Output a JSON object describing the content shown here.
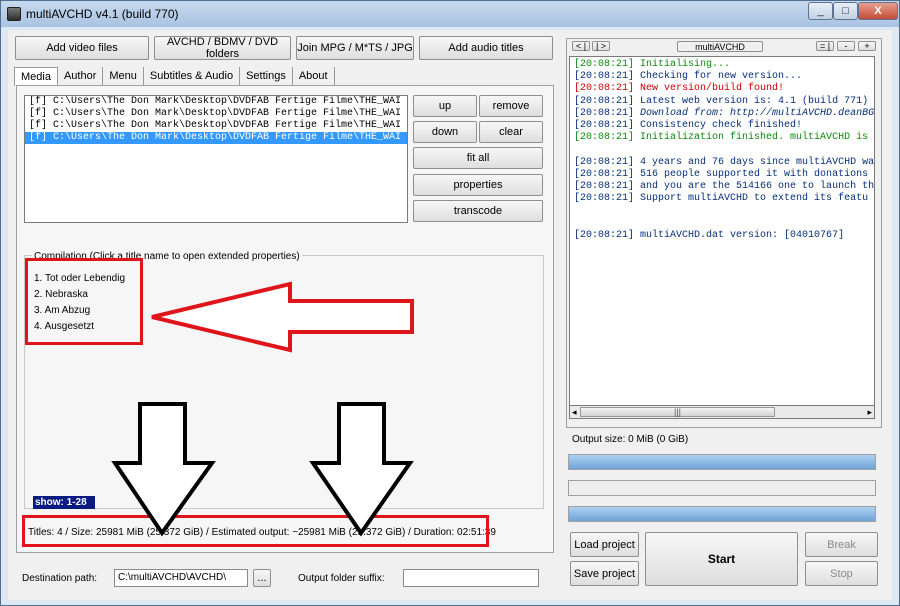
{
  "window": {
    "title": "multiAVCHD v4.1 (build 770)",
    "min": "_",
    "max": "□",
    "close": "X"
  },
  "toolbar": {
    "add_video": "Add video files",
    "avchd": "AVCHD / BDMV / DVD folders",
    "join": "Join MPG / M*TS / JPG",
    "add_audio": "Add audio titles"
  },
  "tabs": [
    "Media",
    "Author",
    "Menu",
    "Subtitles & Audio",
    "Settings",
    "About"
  ],
  "files": [
    "[f] C:\\Users\\The Don Mark\\Desktop\\DVDFAB Fertige Filme\\THE_WAI",
    "[f] C:\\Users\\The Don Mark\\Desktop\\DVDFAB Fertige Filme\\THE_WAI",
    "[f] C:\\Users\\The Don Mark\\Desktop\\DVDFAB Fertige Filme\\THE_WAI",
    "[f] C:\\Users\\The Don Mark\\Desktop\\DVDFAB Fertige Filme\\THE_WAI"
  ],
  "file_buttons": {
    "up": "up",
    "remove": "remove",
    "down": "down",
    "clear": "clear",
    "fit_all": "fit all",
    "properties": "properties",
    "transcode": "transcode"
  },
  "compilation": {
    "label": "Compilation (Click a title name to open extended properties)",
    "titles": [
      "1. Tot oder Lebendig",
      "2. Nebraska",
      "3. Am Abzug",
      "4. Ausgesetzt"
    ],
    "show": "show: 1-28"
  },
  "status": "Titles: 4 / Size: 25981 MiB (25.372 GiB) / Estimated output: ~25981 MiB (25.372 GiB) / Duration: 02:51:39",
  "destination": {
    "label": "Destination path:",
    "value": "C:\\multiAVCHD\\AVCHD\\",
    "browse": "...",
    "suffix_label": "Output folder suffix:",
    "suffix_value": ""
  },
  "log_header": {
    "prev": "< |",
    "next": "| >",
    "title": "multiAVCHD",
    "b1": "= |",
    "b2": "-",
    "b3": "+"
  },
  "log": [
    {
      "time": "[20:08:21]",
      "msg": "Initialising...",
      "color": "#0a8a0a"
    },
    {
      "time": "[20:08:21]",
      "msg": "Checking for new version...",
      "color": "#062e7a"
    },
    {
      "time": "[20:08:21]",
      "msg": "New version/build found!",
      "color": "#d00000"
    },
    {
      "time": "[20:08:21]",
      "msg": "Latest web version is: 4.1 (build 771)",
      "color": "#062e7a"
    },
    {
      "time": "[20:08:21]",
      "msg": "Download from: http://multiAVCHD.deanBG",
      "color": "#062e7a"
    },
    {
      "time": "[20:08:21]",
      "msg": "Consistency check finished!",
      "color": "#062e7a"
    },
    {
      "time": "[20:08:21]",
      "msg": "Initialization finished. multiAVCHD is",
      "color": "#0a8a0a"
    },
    {
      "time": "",
      "msg": "",
      "color": "#062e7a"
    },
    {
      "time": "[20:08:21]",
      "msg": "4 years and 76 days since multiAVCHD wa",
      "color": "#062e7a"
    },
    {
      "time": "[20:08:21]",
      "msg": "516 people supported it with donations",
      "color": "#062e7a"
    },
    {
      "time": "[20:08:21]",
      "msg": "and you are the 514166 one to launch th",
      "color": "#062e7a"
    },
    {
      "time": "[20:08:21]",
      "msg": "Support multiAVCHD to extend its featu",
      "color": "#062e7a"
    },
    {
      "time": "",
      "msg": "",
      "color": "#062e7a"
    },
    {
      "time": "",
      "msg": "",
      "color": "#062e7a"
    },
    {
      "time": "[20:08:21]",
      "msg": "multiAVCHD.dat version: [04010767]",
      "color": "#062e7a"
    }
  ],
  "output_size": "Output size: 0 MiB (0 GiB)",
  "progress": [
    1.0,
    0.0,
    1.0
  ],
  "actions": {
    "load": "Load project",
    "save": "Save project",
    "start": "Start",
    "break": "Break",
    "stop": "Stop"
  },
  "annotations": {
    "arrow_color": "#e0141b"
  }
}
